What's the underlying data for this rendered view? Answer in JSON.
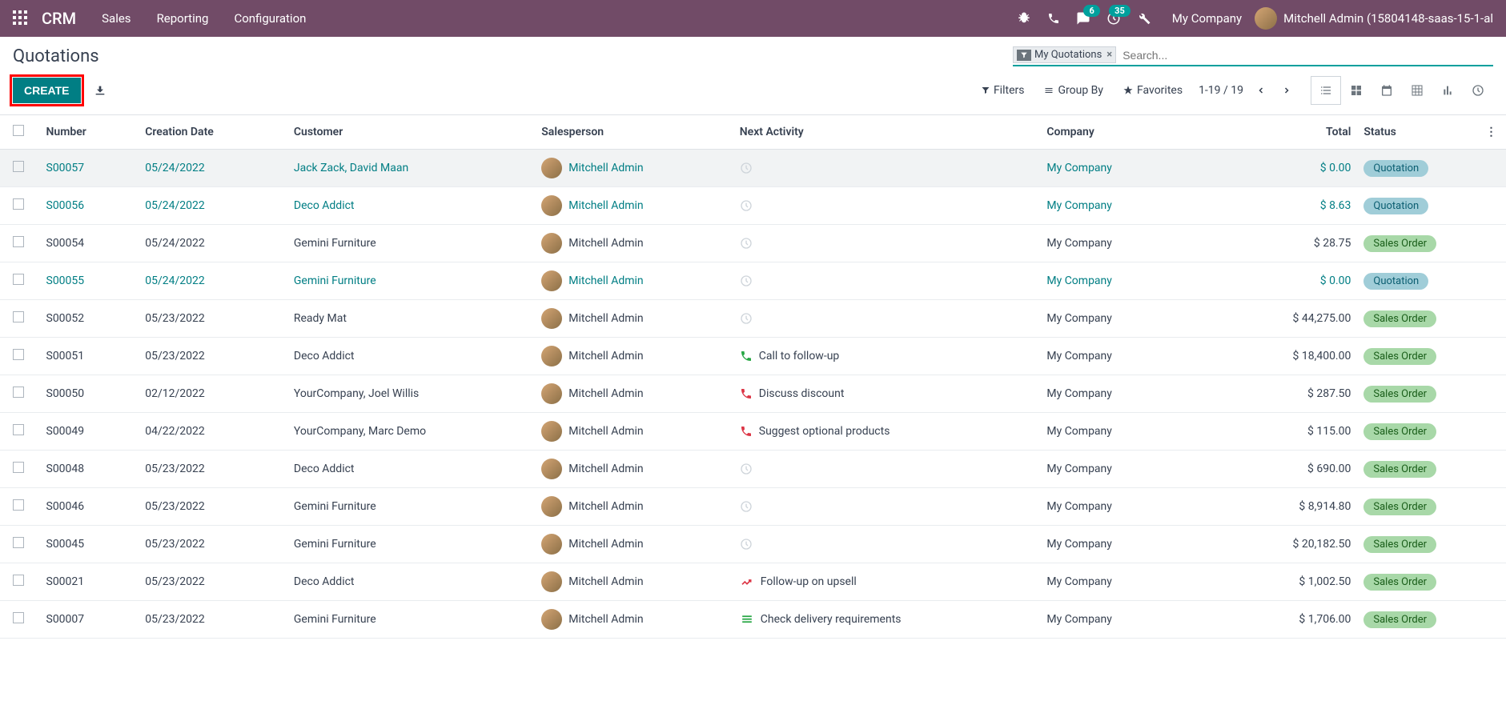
{
  "navbar": {
    "brand": "CRM",
    "menu": [
      "Sales",
      "Reporting",
      "Configuration"
    ],
    "badge_messages": "6",
    "badge_activities": "35",
    "company": "My Company",
    "user": "Mitchell Admin (15804148-saas-15-1-al"
  },
  "page": {
    "title": "Quotations",
    "create_label": "CREATE",
    "filter_tag": "My Quotations",
    "search_placeholder": "Search...",
    "filters_label": "Filters",
    "groupby_label": "Group By",
    "favorites_label": "Favorites",
    "pager": "1-19 / 19"
  },
  "columns": {
    "number": "Number",
    "date": "Creation Date",
    "customer": "Customer",
    "salesperson": "Salesperson",
    "activity": "Next Activity",
    "company": "Company",
    "total": "Total",
    "status": "Status"
  },
  "rows": [
    {
      "number": "S00057",
      "date": "05/24/2022",
      "customer": "Jack Zack, David Maan",
      "salesperson": "Mitchell Admin",
      "activity": "",
      "activity_icon": "clock",
      "company": "My Company",
      "total": "$ 0.00",
      "status": "Quotation",
      "linked": true,
      "hl": true
    },
    {
      "number": "S00056",
      "date": "05/24/2022",
      "customer": "Deco Addict",
      "salesperson": "Mitchell Admin",
      "activity": "",
      "activity_icon": "clock",
      "company": "My Company",
      "total": "$ 8.63",
      "status": "Quotation",
      "linked": true
    },
    {
      "number": "S00054",
      "date": "05/24/2022",
      "customer": "Gemini Furniture",
      "salesperson": "Mitchell Admin",
      "activity": "",
      "activity_icon": "clock",
      "company": "My Company",
      "total": "$ 28.75",
      "status": "Sales Order",
      "linked": false
    },
    {
      "number": "S00055",
      "date": "05/24/2022",
      "customer": "Gemini Furniture",
      "salesperson": "Mitchell Admin",
      "activity": "",
      "activity_icon": "clock",
      "company": "My Company",
      "total": "$ 0.00",
      "status": "Quotation",
      "linked": true
    },
    {
      "number": "S00052",
      "date": "05/23/2022",
      "customer": "Ready Mat",
      "salesperson": "Mitchell Admin",
      "activity": "",
      "activity_icon": "clock",
      "company": "My Company",
      "total": "$ 44,275.00",
      "status": "Sales Order",
      "linked": false
    },
    {
      "number": "S00051",
      "date": "05/23/2022",
      "customer": "Deco Addict",
      "salesperson": "Mitchell Admin",
      "activity": "Call to follow-up",
      "activity_icon": "phone-green",
      "company": "My Company",
      "total": "$ 18,400.00",
      "status": "Sales Order",
      "linked": false
    },
    {
      "number": "S00050",
      "date": "02/12/2022",
      "customer": "YourCompany, Joel Willis",
      "salesperson": "Mitchell Admin",
      "activity": "Discuss discount",
      "activity_icon": "phone-red",
      "company": "My Company",
      "total": "$ 287.50",
      "status": "Sales Order",
      "linked": false
    },
    {
      "number": "S00049",
      "date": "04/22/2022",
      "customer": "YourCompany, Marc Demo",
      "salesperson": "Mitchell Admin",
      "activity": "Suggest optional products",
      "activity_icon": "phone-red",
      "company": "My Company",
      "total": "$ 115.00",
      "status": "Sales Order",
      "linked": false
    },
    {
      "number": "S00048",
      "date": "05/23/2022",
      "customer": "Deco Addict",
      "salesperson": "Mitchell Admin",
      "activity": "",
      "activity_icon": "clock",
      "company": "My Company",
      "total": "$ 690.00",
      "status": "Sales Order",
      "linked": false
    },
    {
      "number": "S00046",
      "date": "05/23/2022",
      "customer": "Gemini Furniture",
      "salesperson": "Mitchell Admin",
      "activity": "",
      "activity_icon": "clock",
      "company": "My Company",
      "total": "$ 8,914.80",
      "status": "Sales Order",
      "linked": false
    },
    {
      "number": "S00045",
      "date": "05/23/2022",
      "customer": "Gemini Furniture",
      "salesperson": "Mitchell Admin",
      "activity": "",
      "activity_icon": "clock",
      "company": "My Company",
      "total": "$ 20,182.50",
      "status": "Sales Order",
      "linked": false
    },
    {
      "number": "S00021",
      "date": "05/23/2022",
      "customer": "Deco Addict",
      "salesperson": "Mitchell Admin",
      "activity": "Follow-up on upsell",
      "activity_icon": "upsell",
      "company": "My Company",
      "total": "$ 1,002.50",
      "status": "Sales Order",
      "linked": false
    },
    {
      "number": "S00007",
      "date": "05/23/2022",
      "customer": "Gemini Furniture",
      "salesperson": "Mitchell Admin",
      "activity": "Check delivery requirements",
      "activity_icon": "delivery",
      "company": "My Company",
      "total": "$ 1,706.00",
      "status": "Sales Order",
      "linked": false
    }
  ]
}
